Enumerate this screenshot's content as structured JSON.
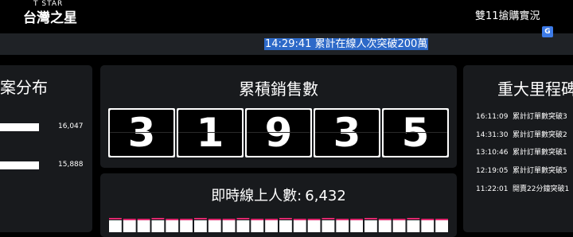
{
  "header": {
    "logo_small": "T STAR",
    "logo_main": "台灣之星",
    "page_title": "雙11搶購實況"
  },
  "ticker": {
    "text": "14:29:41 累計在線人次突破200萬"
  },
  "translate_icon": {
    "glyph": "G"
  },
  "distribution": {
    "title": "案分布",
    "items": [
      {
        "value": "16,047",
        "level": 0.98
      },
      {
        "value": "15,888",
        "level": 0.97
      }
    ]
  },
  "sales": {
    "title": "累積銷售數",
    "digits": [
      "3",
      "1",
      "9",
      "3",
      "5"
    ]
  },
  "online": {
    "label": "即時線上人數:",
    "value": "6,432",
    "bar_color": "#e0286e"
  },
  "milestones": {
    "title": "重大里程碑",
    "items": [
      {
        "time": "16:11:09",
        "text": "累計訂單數突破3"
      },
      {
        "time": "14:31:30",
        "text": "累計訂單數突破2"
      },
      {
        "time": "13:10:46",
        "text": "累計訂單數突破1"
      },
      {
        "time": "12:19:05",
        "text": "累計訂單數突破5"
      },
      {
        "time": "11:22:01",
        "text": "開賣22分鐘突破1"
      }
    ]
  }
}
